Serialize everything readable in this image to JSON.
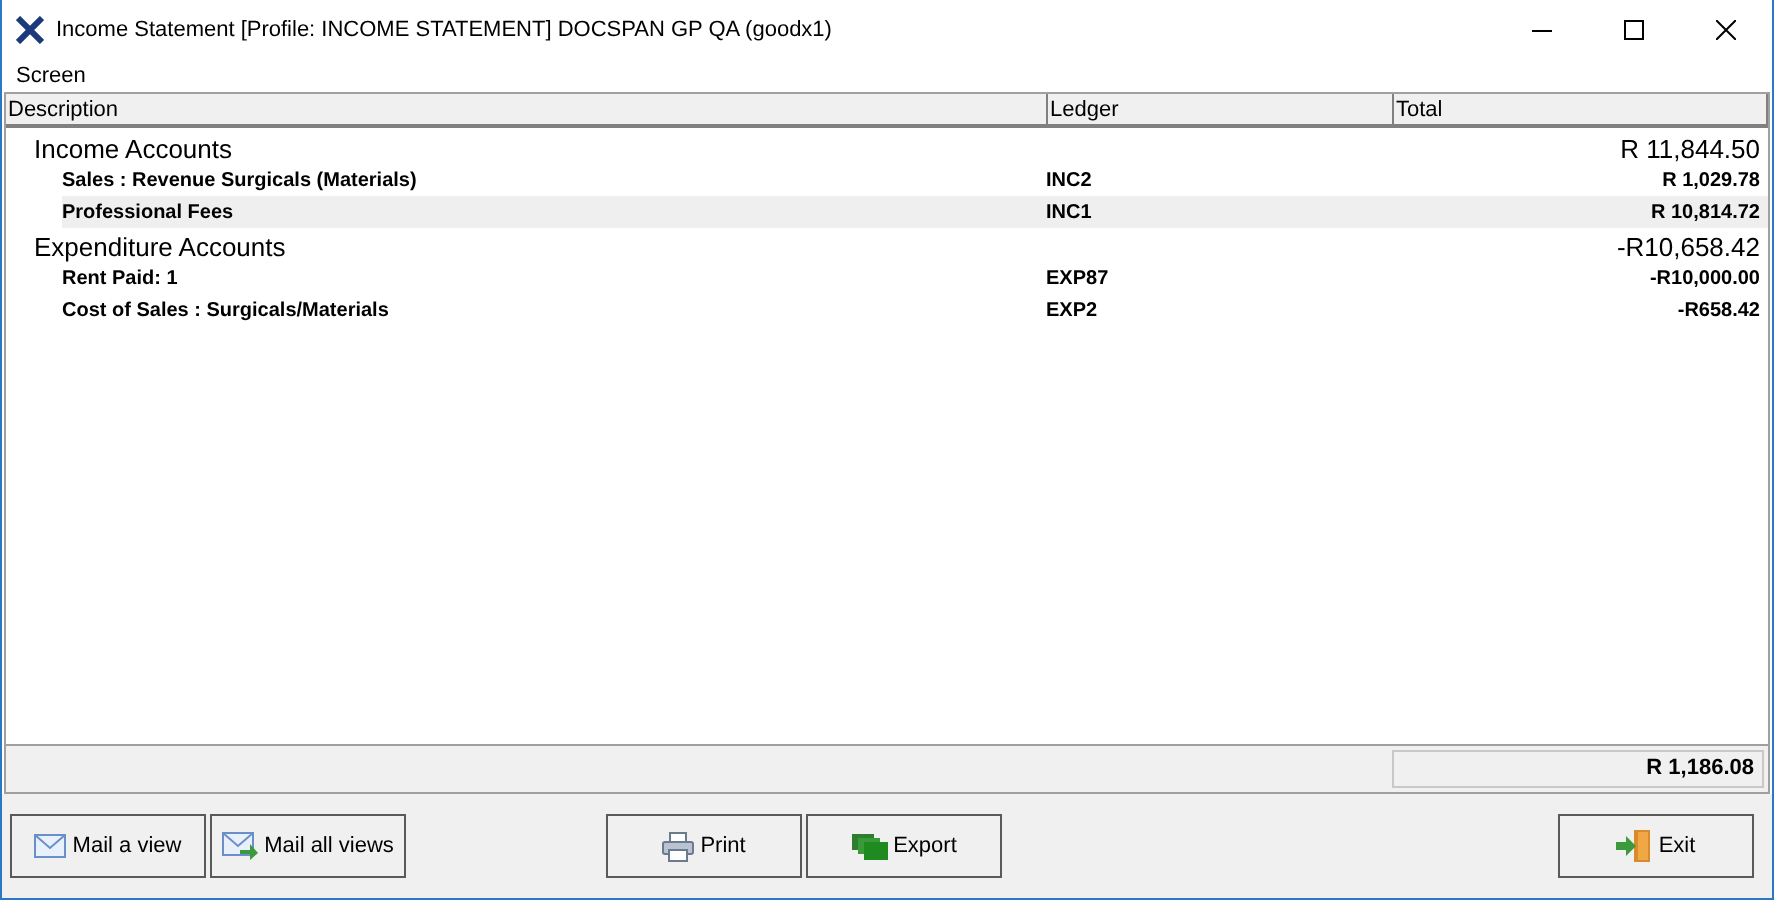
{
  "window": {
    "title": "Income Statement  [Profile: INCOME STATEMENT] DOCSPAN GP QA (goodx1)"
  },
  "menu": [
    "Screen"
  ],
  "table": {
    "columns": [
      "Description",
      "Ledger",
      "Total"
    ],
    "rows": [
      {
        "kind": "group",
        "description": "Income Accounts",
        "total": "R 11,844.50",
        "selected": false
      },
      {
        "kind": "item",
        "description": "Sales : Revenue Surgicals (Materials)",
        "ledger": "INC2",
        "total": "R 1,029.78",
        "selected": false
      },
      {
        "kind": "item",
        "description": "Professional Fees",
        "ledger": "INC1",
        "total": "R 10,814.72",
        "selected": true
      },
      {
        "kind": "group",
        "description": "Expenditure Accounts",
        "total": "-R10,658.42",
        "selected": false
      },
      {
        "kind": "item",
        "description": "Rent Paid: 1",
        "ledger": "EXP87",
        "total": "-R10,000.00",
        "selected": false
      },
      {
        "kind": "item",
        "description": "Cost of Sales : Surgicals/Materials",
        "ledger": "EXP2",
        "total": "-R658.42",
        "selected": false
      }
    ]
  },
  "grand_total": "R 1,186.08",
  "buttons": [
    {
      "kind": "mail",
      "label": "Mail a view"
    },
    {
      "kind": "mail-all",
      "label": "Mail all views"
    },
    {
      "kind": "print",
      "label": "Print"
    },
    {
      "kind": "export",
      "label": "Export"
    },
    {
      "kind": "exit",
      "label": "Exit"
    }
  ]
}
